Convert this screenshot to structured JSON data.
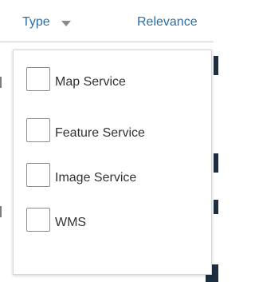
{
  "header": {
    "type_label": "Type",
    "sort_label": "Relevance"
  },
  "filter_menu": {
    "options": [
      {
        "label": "Map Service",
        "checked": false
      },
      {
        "label": "Feature Service",
        "checked": false
      },
      {
        "label": "Image Service",
        "checked": false
      },
      {
        "label": "WMS",
        "checked": false
      }
    ]
  },
  "icons": {
    "type_caret": "chevron-down-icon"
  },
  "colors": {
    "link": "#2b6ea8",
    "text": "#323232",
    "checkbox_border": "#8d8d8d",
    "dark_bg": "#1c2e40"
  }
}
